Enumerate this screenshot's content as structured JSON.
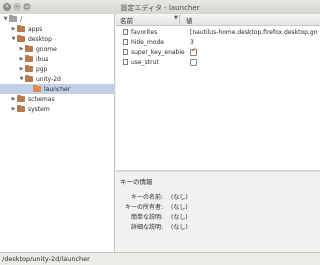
{
  "window": {
    "title": "設定エディタ - launcher",
    "close_glyph": "×",
    "min_glyph": "–",
    "max_glyph": "□"
  },
  "tree": {
    "items": [
      {
        "label": "/",
        "depth": 0,
        "expanded": true,
        "selected": false,
        "icon": "folder-root-icon"
      },
      {
        "label": "apps",
        "depth": 1,
        "expanded": false,
        "selected": false,
        "icon": "folder-icon"
      },
      {
        "label": "desktop",
        "depth": 1,
        "expanded": true,
        "selected": false,
        "icon": "folder-icon"
      },
      {
        "label": "gnome",
        "depth": 2,
        "expanded": false,
        "selected": false,
        "icon": "folder-icon"
      },
      {
        "label": "ibus",
        "depth": 2,
        "expanded": false,
        "selected": false,
        "icon": "folder-icon"
      },
      {
        "label": "pgp",
        "depth": 2,
        "expanded": false,
        "selected": false,
        "icon": "folder-icon"
      },
      {
        "label": "unity-2d",
        "depth": 2,
        "expanded": true,
        "selected": false,
        "icon": "folder-icon"
      },
      {
        "label": "launcher",
        "depth": 3,
        "expanded": null,
        "selected": true,
        "icon": "folder-open-icon"
      },
      {
        "label": "schemas",
        "depth": 1,
        "expanded": false,
        "selected": false,
        "icon": "folder-icon"
      },
      {
        "label": "system",
        "depth": 1,
        "expanded": false,
        "selected": false,
        "icon": "folder-icon"
      }
    ]
  },
  "keys": {
    "header_name": "名前",
    "header_value": "値",
    "sort_glyph": "▼",
    "rows": [
      {
        "name": "favorites",
        "value": "[nautilus-home.desktop,firefox.desktop,gn",
        "type": "text"
      },
      {
        "name": "hide_mode",
        "value": "3",
        "type": "text"
      },
      {
        "name": "super_key_enable",
        "value": "",
        "type": "checkbox",
        "checked": true
      },
      {
        "name": "use_strut",
        "value": "",
        "type": "checkbox",
        "checked": false
      }
    ]
  },
  "key_info": {
    "title": "キーの情報",
    "rows": [
      {
        "label": "キーの名前:",
        "value": "(なし)"
      },
      {
        "label": "キーの所有者:",
        "value": "(なし)"
      },
      {
        "label": "簡単な説明:",
        "value": "(なし)"
      },
      {
        "label": "詳細な説明:",
        "value": "(なし)"
      }
    ]
  },
  "status": {
    "path": "/desktop/unity-2d/launcher"
  },
  "colors": {
    "selection": "#c2cfe6",
    "folder_open": "#de8b4f",
    "folder_closed": "#b77a4f",
    "check_mark": "#d2572a"
  }
}
